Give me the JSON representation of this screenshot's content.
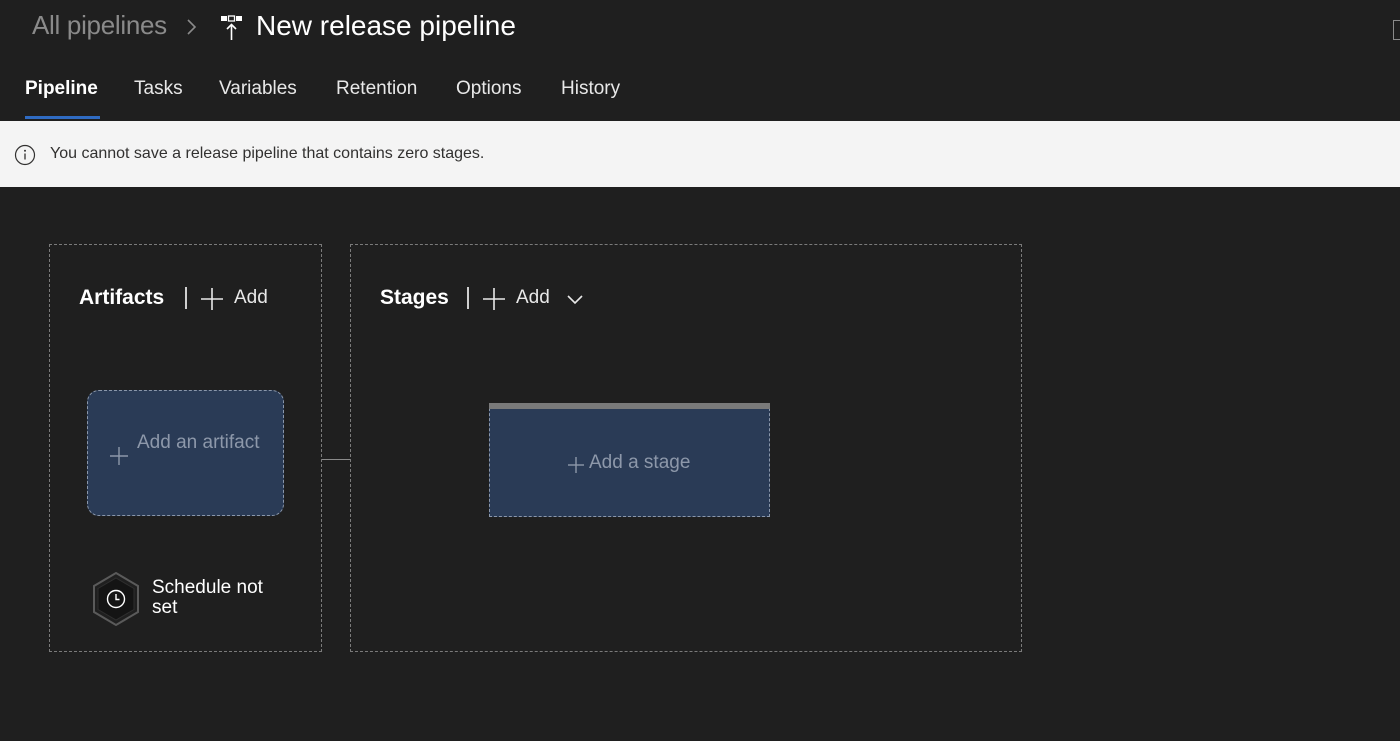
{
  "header": {
    "breadcrumb_root": "All pipelines",
    "title": "New release pipeline"
  },
  "tabs": [
    {
      "label": "Pipeline",
      "active": true
    },
    {
      "label": "Tasks",
      "active": false
    },
    {
      "label": "Variables",
      "active": false
    },
    {
      "label": "Retention",
      "active": false
    },
    {
      "label": "Options",
      "active": false
    },
    {
      "label": "History",
      "active": false
    }
  ],
  "banner": {
    "message": "You cannot save a release pipeline that contains zero stages."
  },
  "artifacts": {
    "title": "Artifacts",
    "add_label": "Add",
    "card_label": "Add an artifact",
    "schedule_label": "Schedule not set"
  },
  "stages": {
    "title": "Stages",
    "add_label": "Add",
    "card_label": "Add a stage"
  },
  "colors": {
    "background": "#1f1f1f",
    "card_fill": "#2a3b56",
    "active_tab_underline": "#2f6bc2",
    "banner_background": "#f4f4f4"
  }
}
